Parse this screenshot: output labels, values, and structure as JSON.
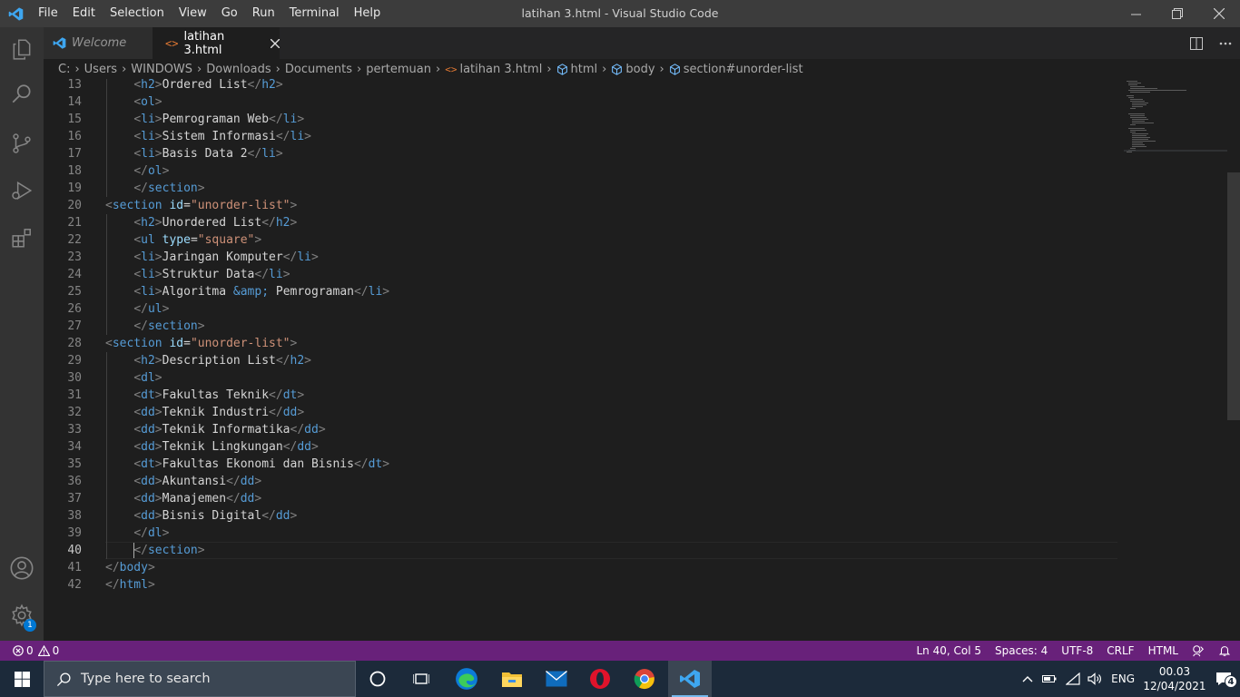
{
  "window": {
    "title": "latihan 3.html - Visual Studio Code",
    "menu": [
      "File",
      "Edit",
      "Selection",
      "View",
      "Go",
      "Run",
      "Terminal",
      "Help"
    ]
  },
  "tabs": [
    {
      "label": "Welcome",
      "active": false,
      "icon": "vscode-icon"
    },
    {
      "label": "latihan 3.html",
      "active": true,
      "icon": "html-file-icon"
    }
  ],
  "breadcrumb": {
    "path": [
      "C:",
      "Users",
      "WINDOWS",
      "Downloads",
      "Documents",
      "pertemuan"
    ],
    "file": "latihan 3.html",
    "symbols": [
      "html",
      "body",
      "section#unorder-list"
    ]
  },
  "editor": {
    "current_line": 40,
    "lines": [
      {
        "n": "13",
        "i": 2,
        "code": "<h2>Ordered List</h2>"
      },
      {
        "n": "14",
        "i": 2,
        "code": "<ol>"
      },
      {
        "n": "15",
        "i": 2,
        "code": "<li>Pemrograman Web</li>"
      },
      {
        "n": "16",
        "i": 2,
        "code": "<li>Sistem Informasi</li>"
      },
      {
        "n": "17",
        "i": 2,
        "code": "<li>Basis Data 2</li>"
      },
      {
        "n": "18",
        "i": 2,
        "code": "</ol>"
      },
      {
        "n": "19",
        "i": 2,
        "code": "</section>"
      },
      {
        "n": "20",
        "i": 0,
        "code": "<section id=\"unorder-list\">"
      },
      {
        "n": "21",
        "i": 2,
        "code": "<h2>Unordered List</h2>"
      },
      {
        "n": "22",
        "i": 2,
        "code": "<ul type=\"square\">"
      },
      {
        "n": "23",
        "i": 2,
        "code": "<li>Jaringan Komputer</li>"
      },
      {
        "n": "24",
        "i": 2,
        "code": "<li>Struktur Data</li>"
      },
      {
        "n": "25",
        "i": 2,
        "code": "<li>Algoritma &amp; Pemrograman</li>"
      },
      {
        "n": "26",
        "i": 2,
        "code": "</ul>"
      },
      {
        "n": "27",
        "i": 2,
        "code": "</section>"
      },
      {
        "n": "28",
        "i": 0,
        "code": "<section id=\"unorder-list\">"
      },
      {
        "n": "29",
        "i": 2,
        "code": "<h2>Description List</h2>"
      },
      {
        "n": "30",
        "i": 2,
        "code": "<dl>"
      },
      {
        "n": "31",
        "i": 2,
        "code": "<dt>Fakultas Teknik</dt>"
      },
      {
        "n": "32",
        "i": 2,
        "code": "<dd>Teknik Industri</dd>"
      },
      {
        "n": "33",
        "i": 2,
        "code": "<dd>Teknik Informatika</dd>"
      },
      {
        "n": "34",
        "i": 2,
        "code": "<dd>Teknik Lingkungan</dd>"
      },
      {
        "n": "35",
        "i": 2,
        "code": "<dt>Fakultas Ekonomi dan Bisnis</dt>"
      },
      {
        "n": "36",
        "i": 2,
        "code": "<dd>Akuntansi</dd>"
      },
      {
        "n": "37",
        "i": 2,
        "code": "<dd>Manajemen</dd>"
      },
      {
        "n": "38",
        "i": 2,
        "code": "<dd>Bisnis Digital</dd>"
      },
      {
        "n": "39",
        "i": 2,
        "code": "</dl>"
      },
      {
        "n": "40",
        "i": 2,
        "code": "</section>"
      },
      {
        "n": "41",
        "i": 0,
        "code": "</body>"
      },
      {
        "n": "42",
        "i": 0,
        "code": "</html>"
      }
    ]
  },
  "status": {
    "errors": "0",
    "warnings": "0",
    "position": "Ln 40, Col 5",
    "spaces": "Spaces: 4",
    "encoding": "UTF-8",
    "eol": "CRLF",
    "language": "HTML",
    "color": "#68217a"
  },
  "activity_badge": "1",
  "taskbar": {
    "search_placeholder": "Type here to search",
    "language": "ENG",
    "time": "00.03",
    "date": "12/04/2021",
    "notifications": "4",
    "apps": [
      "task-view-icon",
      "widgets-icon",
      "edge-icon",
      "file-explorer-icon",
      "mail-icon",
      "opera-icon",
      "chrome-icon",
      "vscode-icon"
    ]
  }
}
